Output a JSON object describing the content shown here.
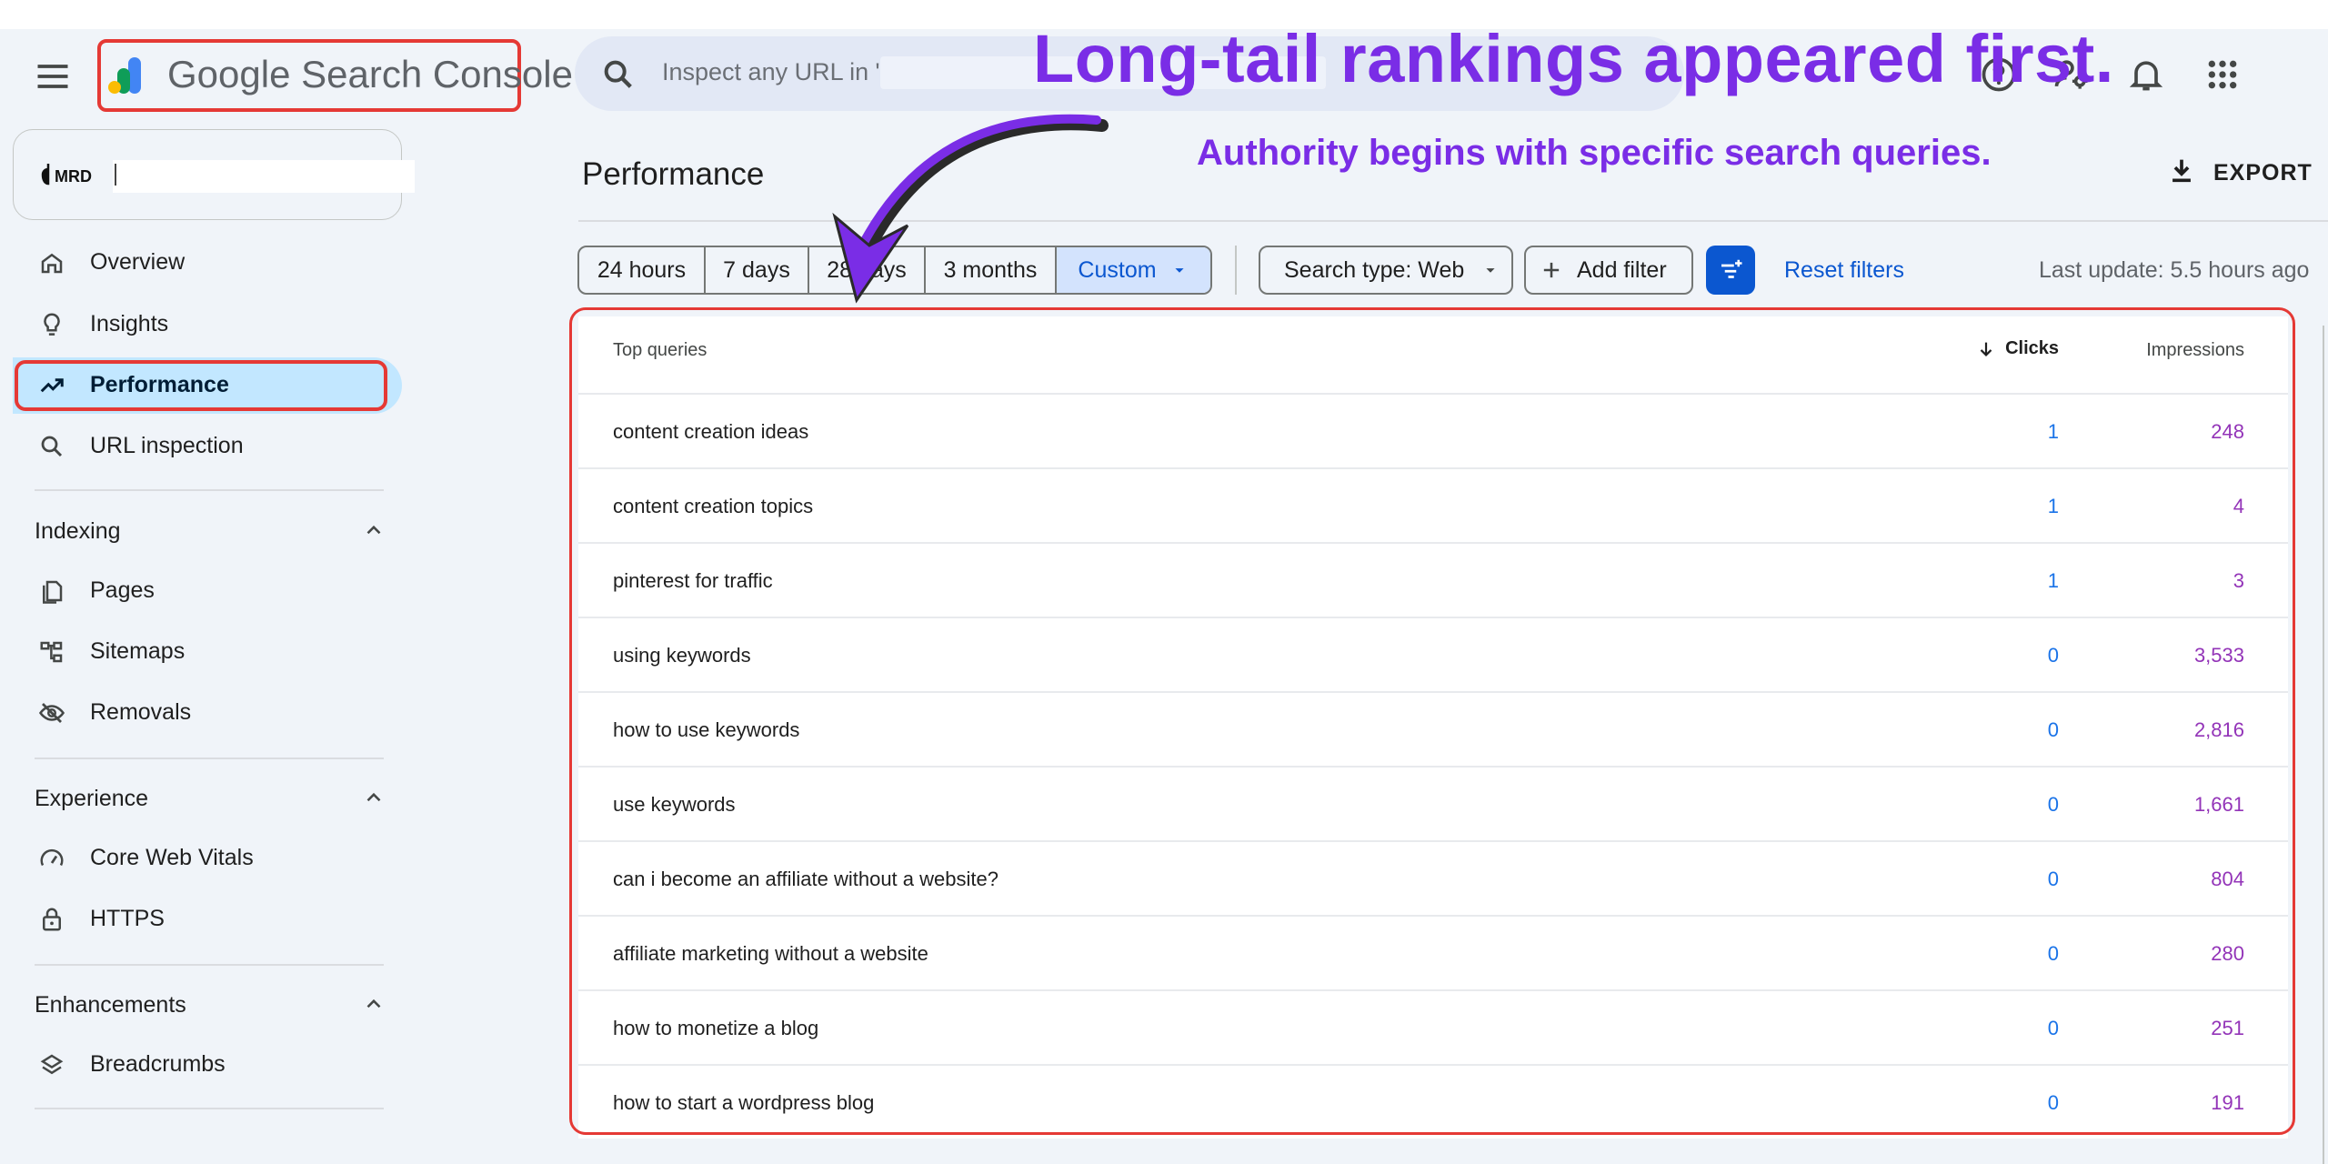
{
  "annotation": {
    "headline": "Long-tail rankings appeared first.",
    "subline": "Authority begins with specific search queries.",
    "accent_color": "#7a2de6"
  },
  "header": {
    "app_title": "Google Search Console",
    "search_placeholder": "Inspect any URL in \""
  },
  "property": {
    "logo_text": "MRD"
  },
  "sidebar": {
    "items": [
      {
        "label": "Overview",
        "icon": "home-icon"
      },
      {
        "label": "Insights",
        "icon": "lightbulb-icon"
      },
      {
        "label": "Performance",
        "icon": "trending-up-icon",
        "active": true
      },
      {
        "label": "URL inspection",
        "icon": "search-icon"
      }
    ],
    "indexing": {
      "title": "Indexing",
      "items": [
        {
          "label": "Pages",
          "icon": "pages-icon"
        },
        {
          "label": "Sitemaps",
          "icon": "sitemap-icon"
        },
        {
          "label": "Removals",
          "icon": "eye-off-icon"
        }
      ]
    },
    "experience": {
      "title": "Experience",
      "items": [
        {
          "label": "Core Web Vitals",
          "icon": "speed-icon"
        },
        {
          "label": "HTTPS",
          "icon": "lock-icon"
        }
      ]
    },
    "enhancements": {
      "title": "Enhancements",
      "items": [
        {
          "label": "Breadcrumbs",
          "icon": "layers-icon"
        }
      ]
    }
  },
  "main": {
    "title": "Performance",
    "export_label": "EXPORT",
    "date_ranges": [
      "24 hours",
      "7 days",
      "28 days",
      "3 months",
      "Custom"
    ],
    "selected_range": "Custom",
    "search_type": "Search type: Web",
    "add_filter": "Add filter",
    "reset_filters": "Reset filters",
    "last_update": "Last update: 5.5 hours ago"
  },
  "table": {
    "headers": {
      "query": "Top queries",
      "clicks": "Clicks",
      "impressions": "Impressions"
    },
    "rows": [
      {
        "query": "content creation ideas",
        "clicks": "1",
        "impressions": "248"
      },
      {
        "query": "content creation topics",
        "clicks": "1",
        "impressions": "4"
      },
      {
        "query": "pinterest for traffic",
        "clicks": "1",
        "impressions": "3"
      },
      {
        "query": "using keywords",
        "clicks": "0",
        "impressions": "3,533"
      },
      {
        "query": "how to use keywords",
        "clicks": "0",
        "impressions": "2,816"
      },
      {
        "query": "use keywords",
        "clicks": "0",
        "impressions": "1,661"
      },
      {
        "query": "can i become an affiliate without a website?",
        "clicks": "0",
        "impressions": "804"
      },
      {
        "query": "affiliate marketing without a website",
        "clicks": "0",
        "impressions": "280"
      },
      {
        "query": "how to monetize a blog",
        "clicks": "0",
        "impressions": "251"
      },
      {
        "query": "how to start a wordpress blog",
        "clicks": "0",
        "impressions": "191"
      }
    ]
  },
  "colors": {
    "highlight_outline": "#e53935",
    "clicks": "#1a73e8",
    "impressions": "#9334b8",
    "primary": "#0b57d0"
  }
}
